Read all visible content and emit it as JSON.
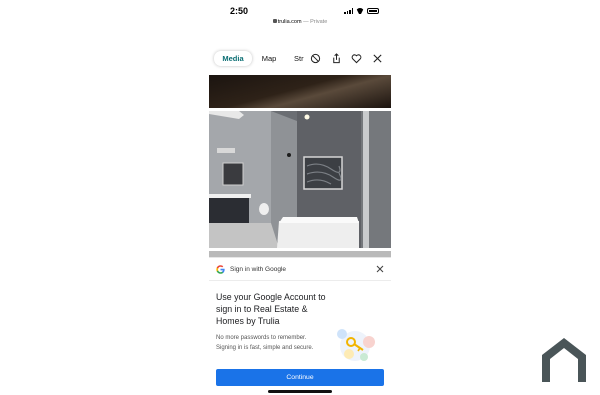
{
  "status_bar": {
    "time": "2:50"
  },
  "browser": {
    "url": "trulia.com",
    "separator": " — ",
    "mode": "Private"
  },
  "tabs": [
    {
      "label": "Media",
      "active": true
    },
    {
      "label": "Map",
      "active": false
    },
    {
      "label": "Str",
      "active": false
    }
  ],
  "toolbar_icons": [
    "block-icon",
    "share-icon",
    "heart-icon",
    "close-icon"
  ],
  "sign_in_sheet": {
    "header_title": "Sign in with Google",
    "heading": "Use your Google Account to sign in to Real Estate & Homes by Trulia",
    "description": "No more passwords to remember. Signing in is fast, simple and secure.",
    "continue_label": "Continue"
  },
  "colors": {
    "accent_tab": "#0b6e73",
    "continue_button": "#1a73e8",
    "logo": "#4a5558"
  }
}
